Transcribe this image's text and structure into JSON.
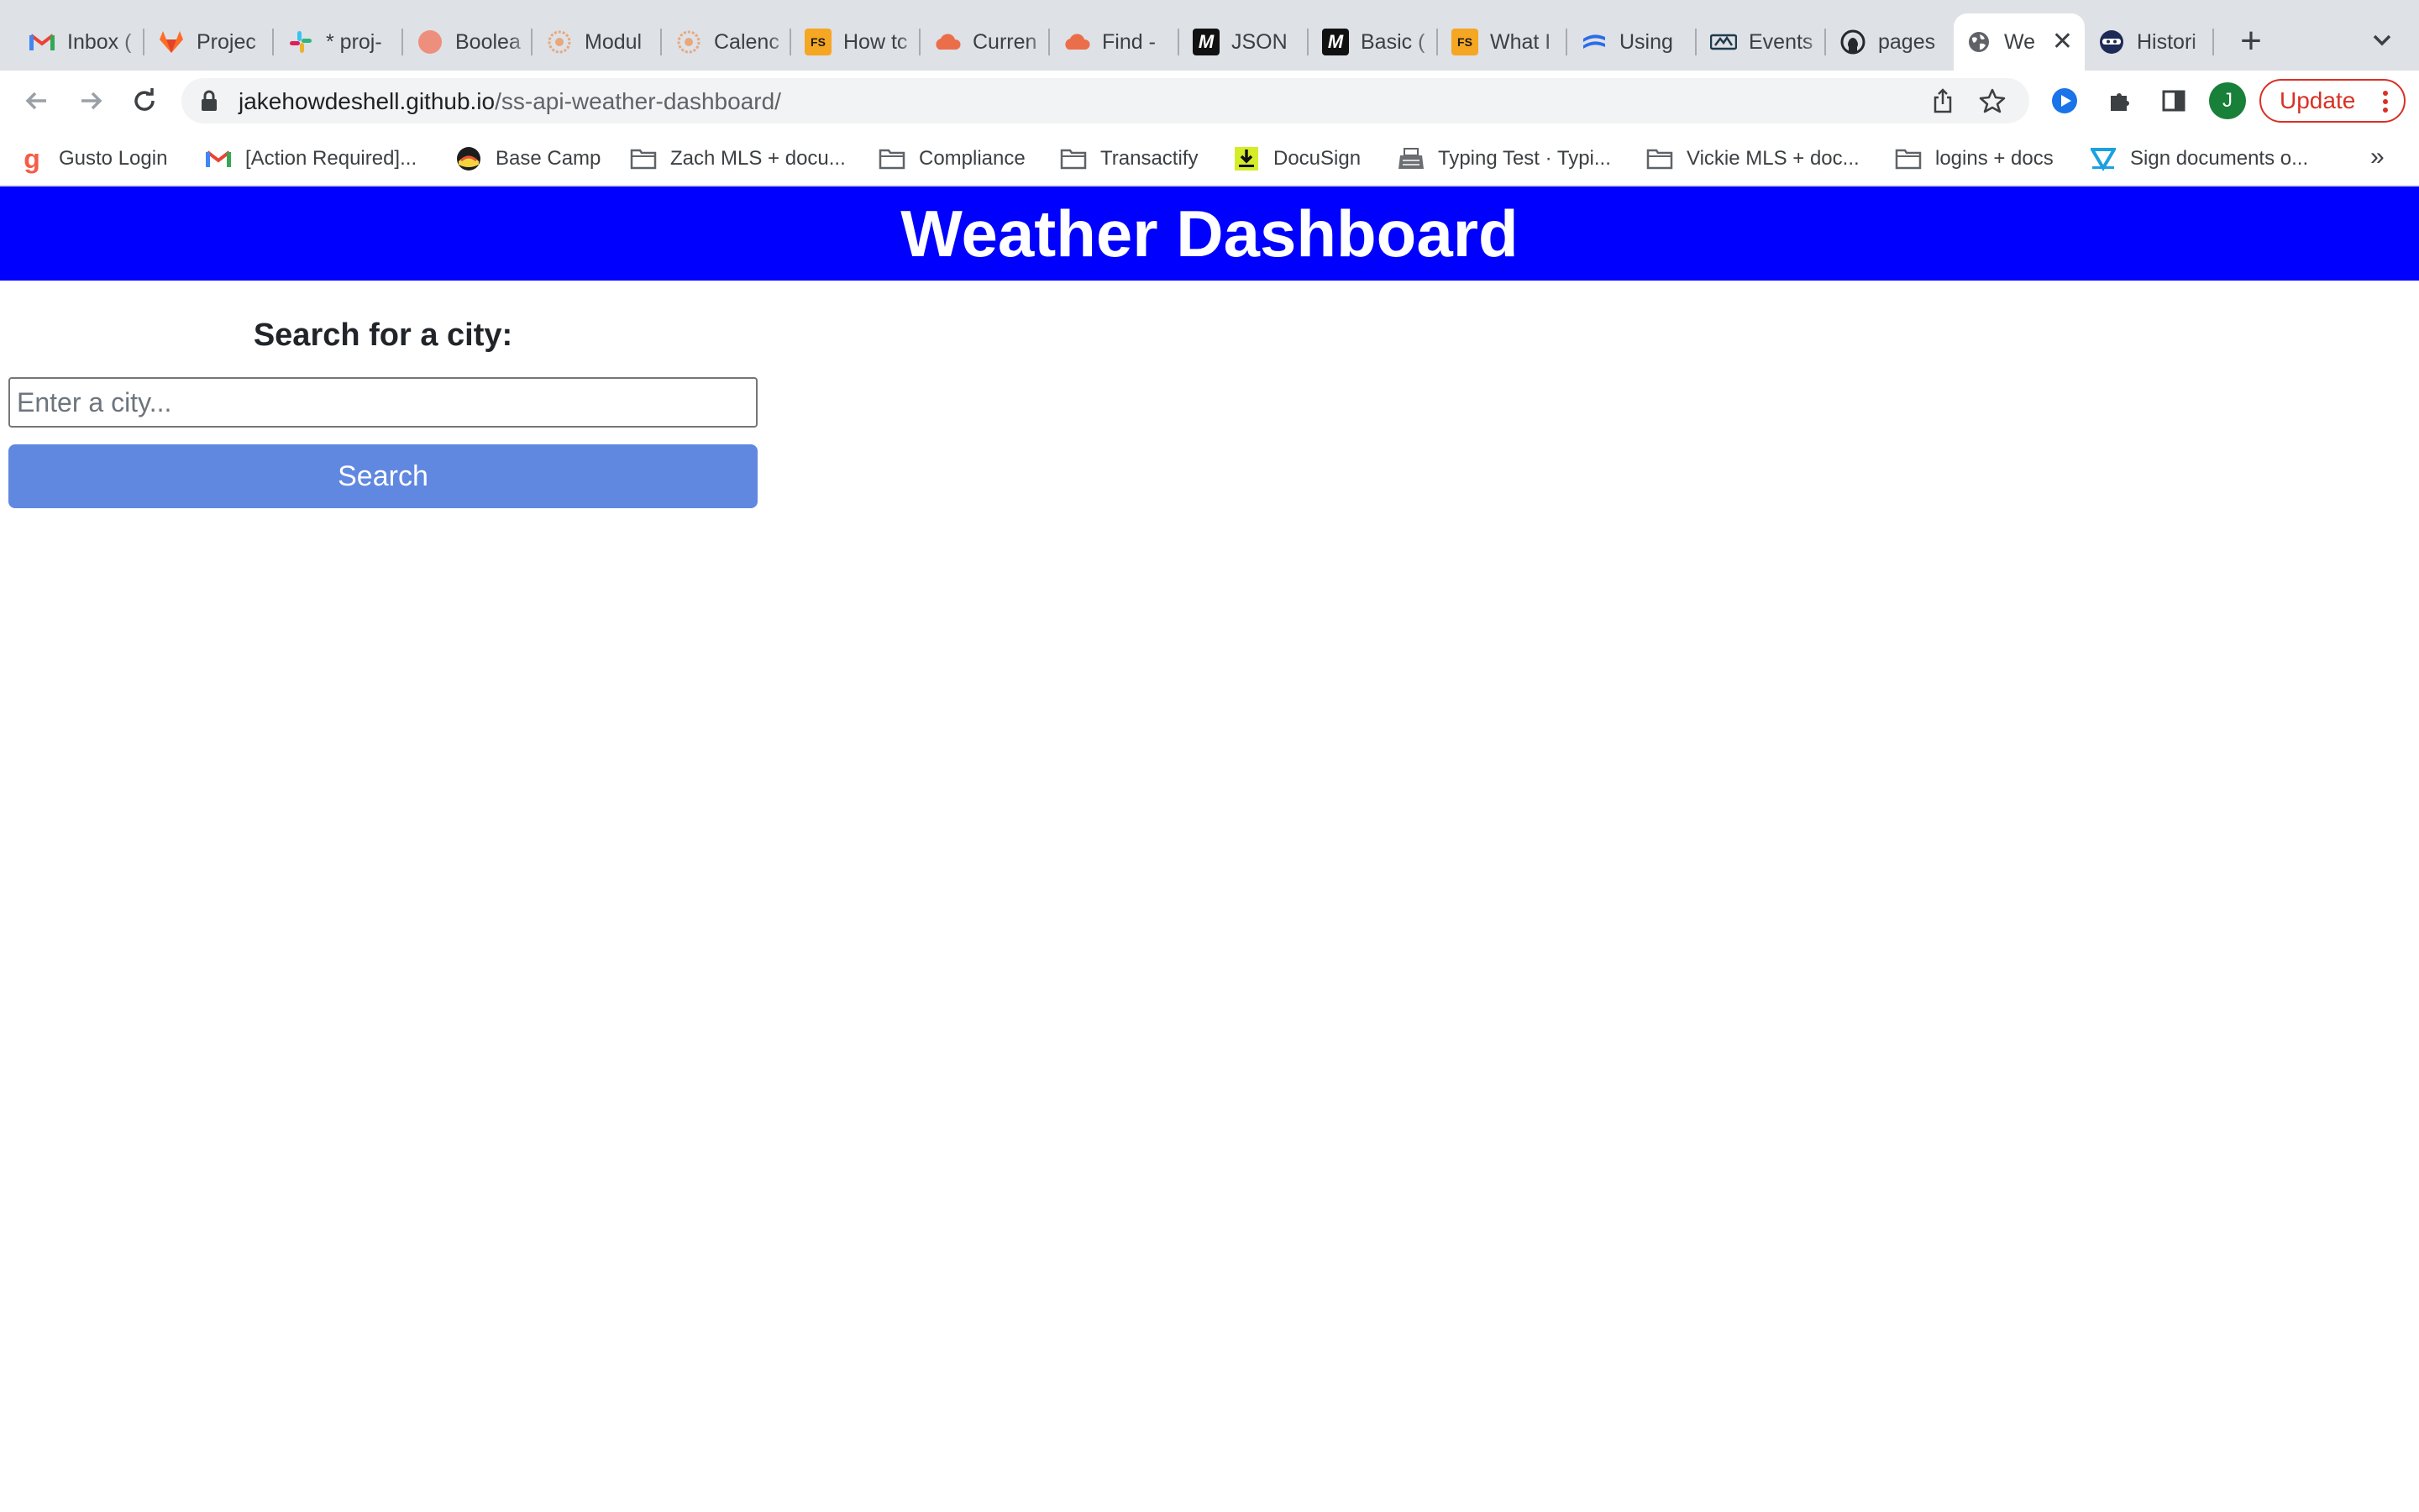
{
  "browser": {
    "tabs": [
      {
        "title": "Inbox (",
        "icon": "gmail-icon",
        "active": false
      },
      {
        "title": "Projec",
        "icon": "gitlab-icon",
        "active": false
      },
      {
        "title": "* proj-",
        "icon": "slack-icon",
        "active": false
      },
      {
        "title": "Boolea",
        "icon": "generic-circle-icon",
        "active": false
      },
      {
        "title": "Modul",
        "icon": "course-icon",
        "active": false
      },
      {
        "title": "Calenc",
        "icon": "course-icon",
        "active": false
      },
      {
        "title": "How tc",
        "icon": "fs-icon",
        "active": false
      },
      {
        "title": "Curren",
        "icon": "cloud-icon",
        "active": false
      },
      {
        "title": "Find -",
        "icon": "cloud-icon",
        "active": false
      },
      {
        "title": "JSON",
        "icon": "m-icon",
        "active": false
      },
      {
        "title": "Basic (",
        "icon": "m-icon",
        "active": false
      },
      {
        "title": "What I",
        "icon": "fs-icon",
        "active": false
      },
      {
        "title": "Using",
        "icon": "wave-icon",
        "active": false
      },
      {
        "title": "Events",
        "icon": "news-icon",
        "active": false
      },
      {
        "title": "pages",
        "icon": "github-icon",
        "active": false
      },
      {
        "title": "We",
        "icon": "globe-icon",
        "active": true
      },
      {
        "title": "Histori",
        "icon": "ninja-icon",
        "active": false
      }
    ],
    "address": {
      "domain": "jakehowdeshell.github.io",
      "path": "/ss-api-weather-dashboard/"
    },
    "profile_initial": "J",
    "update_label": "Update",
    "colors": {
      "tabstrip": "#dee1e6",
      "update_red": "#d93025",
      "profile_green": "#188038"
    }
  },
  "bookmarks": [
    {
      "label": "Gusto Login",
      "icon": "gusto-icon"
    },
    {
      "label": "[Action Required]...",
      "icon": "gmail-icon"
    },
    {
      "label": "Base Camp",
      "icon": "basecamp-icon"
    },
    {
      "label": "Zach MLS + docu...",
      "icon": "folder-icon"
    },
    {
      "label": "Compliance",
      "icon": "folder-icon"
    },
    {
      "label": "Transactify",
      "icon": "folder-icon"
    },
    {
      "label": "DocuSign",
      "icon": "docusign-icon"
    },
    {
      "label": "Typing Test · Typi...",
      "icon": "typewriter-icon"
    },
    {
      "label": "Vickie MLS + doc...",
      "icon": "folder-icon"
    },
    {
      "label": "logins + docs",
      "icon": "folder-icon"
    },
    {
      "label": "Sign documents o...",
      "icon": "sign-icon"
    }
  ],
  "page": {
    "title": "Weather Dashboard",
    "search_heading": "Search for a city:",
    "input_placeholder": "Enter a city...",
    "input_value": "",
    "search_button_label": "Search",
    "colors": {
      "header_bg": "#0000ff",
      "header_text": "#ffffff",
      "button_bg": "#6088e0"
    }
  }
}
